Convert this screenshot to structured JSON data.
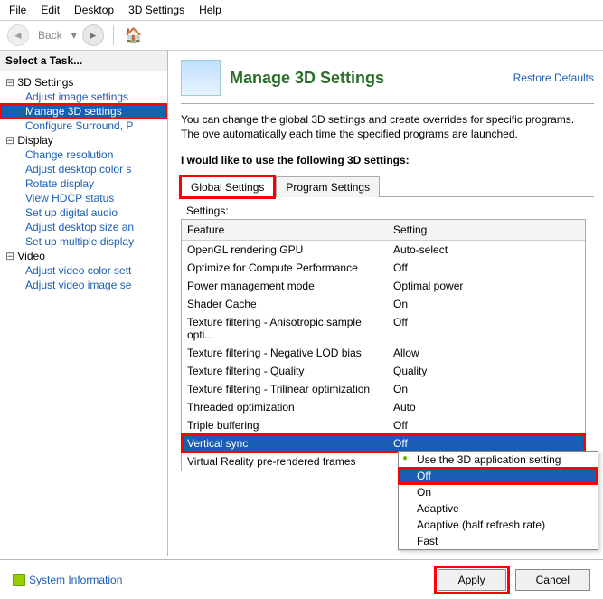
{
  "menu": [
    "File",
    "Edit",
    "Desktop",
    "3D Settings",
    "Help"
  ],
  "toolbar": {
    "back": "Back"
  },
  "sidebar": {
    "title": "Select a Task...",
    "groups": [
      {
        "label": "3D Settings",
        "items": [
          "Adjust image settings",
          "Manage 3D settings",
          "Configure Surround, P"
        ]
      },
      {
        "label": "Display",
        "items": [
          "Change resolution",
          "Adjust desktop color s",
          "Rotate display",
          "View HDCP status",
          "Set up digital audio",
          "Adjust desktop size an",
          "Set up multiple display"
        ]
      },
      {
        "label": "Video",
        "items": [
          "Adjust video color sett",
          "Adjust video image se"
        ]
      }
    ],
    "selected": "Manage 3D settings"
  },
  "page": {
    "title": "Manage 3D Settings",
    "restore": "Restore Defaults",
    "desc": "You can change the global 3D settings and create overrides for specific programs. The ove\nautomatically each time the specified programs are launched.",
    "subhead": "I would like to use the following 3D settings:",
    "tabs": [
      "Global Settings",
      "Program Settings"
    ],
    "active_tab": 0,
    "settings_label": "Settings:",
    "columns": [
      "Feature",
      "Setting"
    ],
    "rows": [
      {
        "f": "OpenGL rendering GPU",
        "s": "Auto-select"
      },
      {
        "f": "Optimize for Compute Performance",
        "s": "Off"
      },
      {
        "f": "Power management mode",
        "s": "Optimal power"
      },
      {
        "f": "Shader Cache",
        "s": "On"
      },
      {
        "f": "Texture filtering - Anisotropic sample opti...",
        "s": "Off"
      },
      {
        "f": "Texture filtering - Negative LOD bias",
        "s": "Allow"
      },
      {
        "f": "Texture filtering - Quality",
        "s": "Quality"
      },
      {
        "f": "Texture filtering - Trilinear optimization",
        "s": "On"
      },
      {
        "f": "Threaded optimization",
        "s": "Auto"
      },
      {
        "f": "Triple buffering",
        "s": "Off"
      },
      {
        "f": "Vertical sync",
        "s": "Off",
        "sel": true
      },
      {
        "f": "Virtual Reality pre-rendered frames",
        "s": ""
      }
    ],
    "dropdown": {
      "options": [
        "Use the 3D application setting",
        "Off",
        "On",
        "Adaptive",
        "Adaptive (half refresh rate)",
        "Fast"
      ],
      "checked": 0,
      "selected": 1
    }
  },
  "footer": {
    "sysinfo": "System Information",
    "apply": "Apply",
    "cancel": "Cancel"
  }
}
